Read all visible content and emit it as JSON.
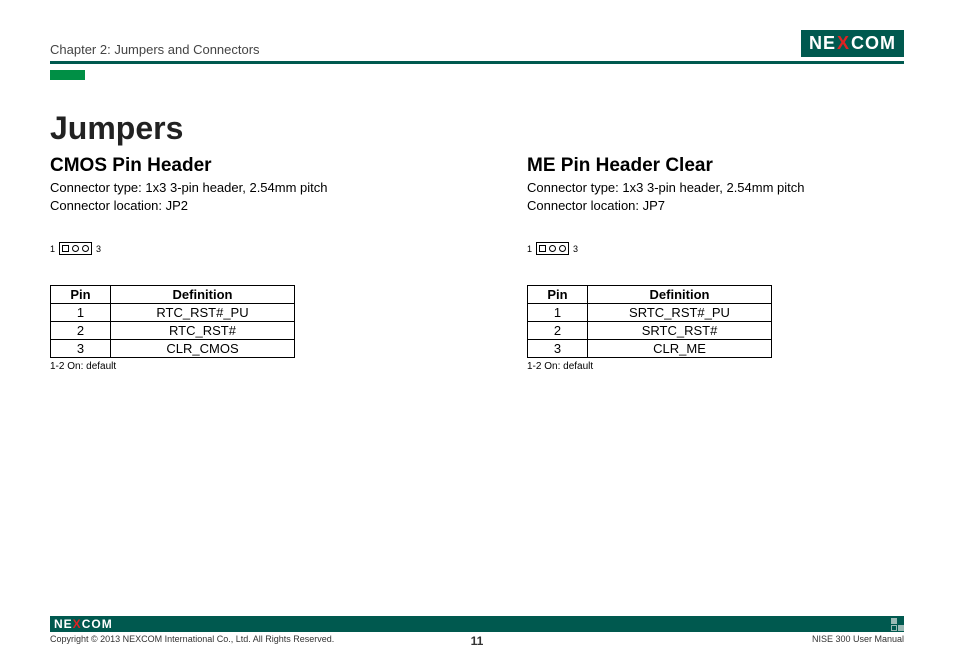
{
  "header": {
    "chapter": "Chapter 2: Jumpers and Connectors",
    "logo_prefix": "NE",
    "logo_x": "X",
    "logo_suffix": "COM"
  },
  "title": "Jumpers",
  "left": {
    "heading": "CMOS Pin Header",
    "spec_line1": "Connector type: 1x3 3-pin header, 2.54mm pitch",
    "spec_line2": "Connector location: JP2",
    "diagram": {
      "left_label": "1",
      "right_label": "3"
    },
    "table": {
      "headers": {
        "pin": "Pin",
        "def": "Definition"
      },
      "rows": [
        {
          "pin": "1",
          "def": "RTC_RST#_PU"
        },
        {
          "pin": "2",
          "def": "RTC_RST#"
        },
        {
          "pin": "3",
          "def": "CLR_CMOS"
        }
      ]
    },
    "note": "1-2 On: default"
  },
  "right": {
    "heading": "ME Pin Header Clear",
    "spec_line1": "Connector type: 1x3 3-pin header, 2.54mm pitch",
    "spec_line2": "Connector location: JP7",
    "diagram": {
      "left_label": "1",
      "right_label": "3"
    },
    "table": {
      "headers": {
        "pin": "Pin",
        "def": "Definition"
      },
      "rows": [
        {
          "pin": "1",
          "def": "SRTC_RST#_PU"
        },
        {
          "pin": "2",
          "def": "SRTC_RST#"
        },
        {
          "pin": "3",
          "def": "CLR_ME"
        }
      ]
    },
    "note": "1-2 On: default"
  },
  "footer": {
    "logo_prefix": "NE",
    "logo_x": "X",
    "logo_suffix": "COM",
    "copyright": "Copyright © 2013 NEXCOM International Co., Ltd. All Rights Reserved.",
    "page": "11",
    "manual": "NISE 300 User Manual"
  }
}
